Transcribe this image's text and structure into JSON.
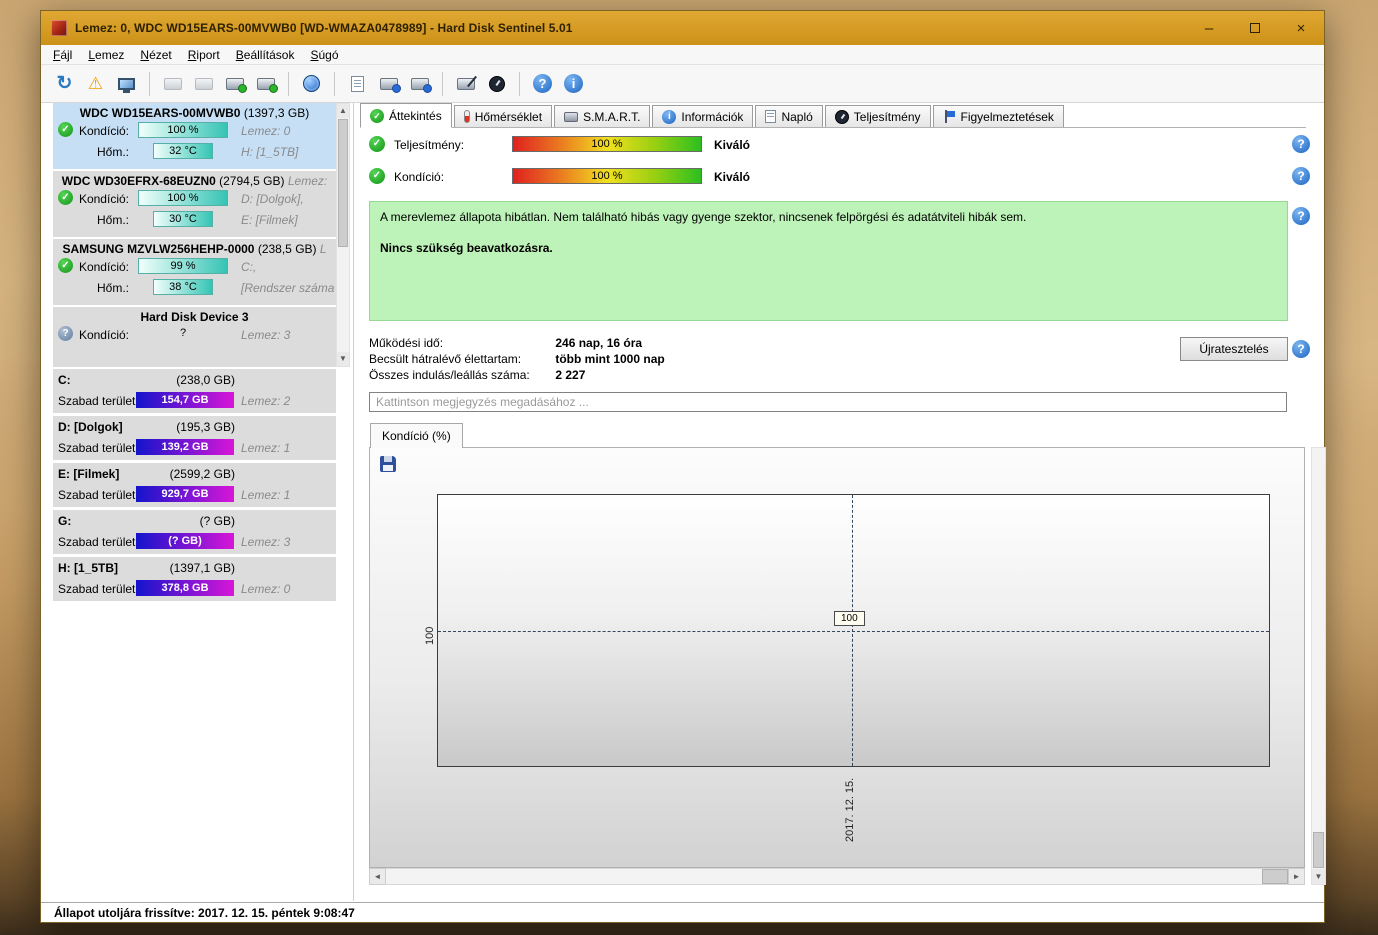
{
  "window": {
    "title": "Lemez: 0, WDC WD15EARS-00MVWB0 [WD-WMAZA0478989]  -  Hard Disk Sentinel 5.01",
    "minimize": "–",
    "close": "×"
  },
  "menu": {
    "items": [
      "Fájl",
      "Lemez",
      "Nézet",
      "Riport",
      "Beállítások",
      "Súgó"
    ]
  },
  "icons": {
    "check": "✓",
    "question": "?",
    "info": "i",
    "warning": "⚠",
    "refresh": "↻",
    "up": "▲",
    "down": "▼",
    "left": "◄",
    "right": "►"
  },
  "sidebar": {
    "disks": [
      {
        "name": "WDC WD15EARS-00MVWB0",
        "size": "(1397,3 GB)",
        "suffix": "",
        "cond_label": "Kondíció:",
        "cond_value": "100 %",
        "right1": "Lemez: 0",
        "temp_label": "Hőm.:",
        "temp_value": "32 °C",
        "right2": "H: [1_5TB]"
      },
      {
        "name": "WDC WD30EFRX-68EUZN0",
        "size": "(2794,5 GB)",
        "suffix": "Lemez:",
        "cond_label": "Kondíció:",
        "cond_value": "100 %",
        "right1": "D: [Dolgok],",
        "temp_label": "Hőm.:",
        "temp_value": "30 °C",
        "right2": "E: [Filmek]"
      },
      {
        "name": "SAMSUNG MZVLW256HEHP-0000",
        "size": "(238,5 GB)",
        "suffix": "L",
        "cond_label": "Kondíció:",
        "cond_value": "99 %",
        "right1": "C:,",
        "temp_label": "Hőm.:",
        "temp_value": "38 °C",
        "right2": "[Rendszer száma"
      },
      {
        "name": "Hard Disk Device 3",
        "size": "",
        "suffix": "",
        "cond_label": "Kondíció:",
        "cond_value": "?",
        "right1": "Lemez: 3"
      }
    ],
    "partitions": [
      {
        "name": "C:",
        "size": "(238,0 GB)",
        "free_label": "Szabad terület",
        "free_value": "154,7 GB",
        "right": "Lemez: 2"
      },
      {
        "name": "D: [Dolgok]",
        "size": "(195,3 GB)",
        "free_label": "Szabad terület",
        "free_value": "139,2 GB",
        "right": "Lemez: 1"
      },
      {
        "name": "E: [Filmek]",
        "size": "(2599,2 GB)",
        "free_label": "Szabad terület",
        "free_value": "929,7 GB",
        "right": "Lemez: 1"
      },
      {
        "name": "G:",
        "size": "(? GB)",
        "free_label": "Szabad terület",
        "free_value": "(? GB)",
        "right": "Lemez: 3"
      },
      {
        "name": "H: [1_5TB]",
        "size": "(1397,1 GB)",
        "free_label": "Szabad terület",
        "free_value": "378,8 GB",
        "right": "Lemez: 0"
      }
    ]
  },
  "tabs": [
    {
      "label": "Áttekintés"
    },
    {
      "label": "Hőmérséklet"
    },
    {
      "label": "S.M.A.R.T."
    },
    {
      "label": "Információk"
    },
    {
      "label": "Napló"
    },
    {
      "label": "Teljesítmény"
    },
    {
      "label": "Figyelmeztetések"
    }
  ],
  "overview": {
    "performance_label": "Teljesítmény:",
    "performance_value": "100 %",
    "performance_rating": "Kiváló",
    "condition_label": "Kondíció:",
    "condition_value": "100 %",
    "condition_rating": "Kiváló",
    "health_text": "A merevlemez állapota hibátlan. Nem található hibás vagy gyenge szektor, nincsenek felpörgési és adatátviteli hibák sem.",
    "health_bold": "Nincs szükség beavatkozásra.",
    "info_rows": [
      {
        "label": "Működési idő:",
        "value": "246 nap, 16 óra"
      },
      {
        "label": "Becsült hátralévő élettartam:",
        "value": "több mint 1000 nap"
      },
      {
        "label": "Összes indulás/leállás száma:",
        "value": "2 227"
      }
    ],
    "retest_button": "Újratesztelés",
    "comment_placeholder": "Kattintson megjegyzés megadásához ..."
  },
  "chart": {
    "tab_label": "Kondíció  (%)"
  },
  "chart_data": {
    "type": "line",
    "title": "Kondíció (%)",
    "x_labels": [
      "2017. 12. 15."
    ],
    "values": [
      100
    ],
    "point_label": "100",
    "y_axis_tick": "100",
    "ylim": [
      0,
      100
    ],
    "grid": "dashed-crosshair-at-datapoint",
    "legend": "none"
  },
  "statusbar": {
    "text": "Állapot utoljára frissítve: 2017. 12. 15. péntek 9:08:47"
  }
}
